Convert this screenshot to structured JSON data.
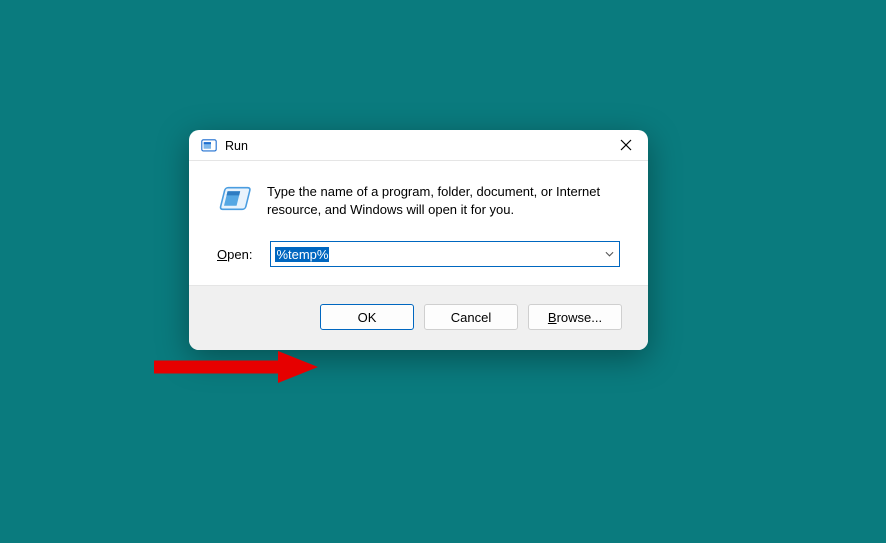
{
  "dialog": {
    "title": "Run",
    "description": "Type the name of a program, folder, document, or Internet resource, and Windows will open it for you.",
    "open_label_pre": "O",
    "open_label_post": "pen:",
    "input_value": "%temp%",
    "buttons": {
      "ok": "OK",
      "cancel": "Cancel",
      "browse_pre": "B",
      "browse_post": "rowse..."
    }
  }
}
